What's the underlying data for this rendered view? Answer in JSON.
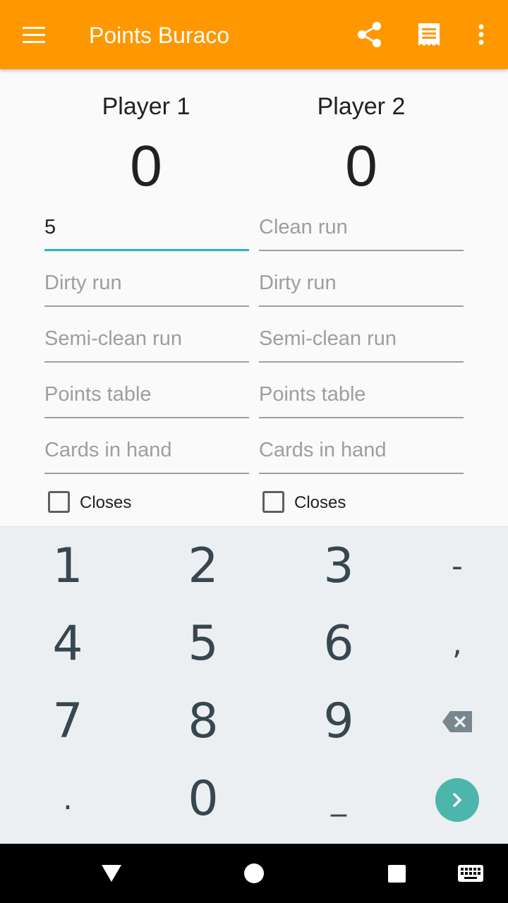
{
  "app": {
    "title": "Points Buraco"
  },
  "appbar": {
    "menu_icon": "menu-icon",
    "share_icon": "share-icon",
    "receipt_icon": "receipt-icon",
    "more_icon": "more-vert-icon",
    "color": "#ff9800"
  },
  "players": [
    {
      "name": "Player 1",
      "score": "0",
      "fields": [
        {
          "value": "5",
          "placeholder": "Clean run"
        },
        {
          "value": "",
          "placeholder": "Dirty run"
        },
        {
          "value": "",
          "placeholder": "Semi-clean run"
        },
        {
          "value": "",
          "placeholder": "Points table"
        },
        {
          "value": "",
          "placeholder": "Cards in hand"
        }
      ],
      "closes_label": "Closes",
      "closes_checked": false
    },
    {
      "name": "Player 2",
      "score": "0",
      "fields": [
        {
          "value": "",
          "placeholder": "Clean run"
        },
        {
          "value": "",
          "placeholder": "Dirty run"
        },
        {
          "value": "",
          "placeholder": "Semi-clean run"
        },
        {
          "value": "",
          "placeholder": "Points table"
        },
        {
          "value": "",
          "placeholder": "Cards in hand"
        }
      ],
      "closes_label": "Closes",
      "closes_checked": false
    }
  ],
  "keypad": {
    "keys": [
      [
        "1",
        "2",
        "3",
        "-"
      ],
      [
        "4",
        "5",
        "6",
        ","
      ],
      [
        "7",
        "8",
        "9",
        "backspace-icon"
      ],
      [
        ".",
        "0",
        "_",
        "enter-icon"
      ]
    ],
    "enter_color": "#4db6ac"
  },
  "navbar": {
    "back_icon": "back-triangle-icon",
    "home_icon": "home-circle-icon",
    "recents_icon": "recents-square-icon",
    "keyboard_icon": "keyboard-icon"
  }
}
